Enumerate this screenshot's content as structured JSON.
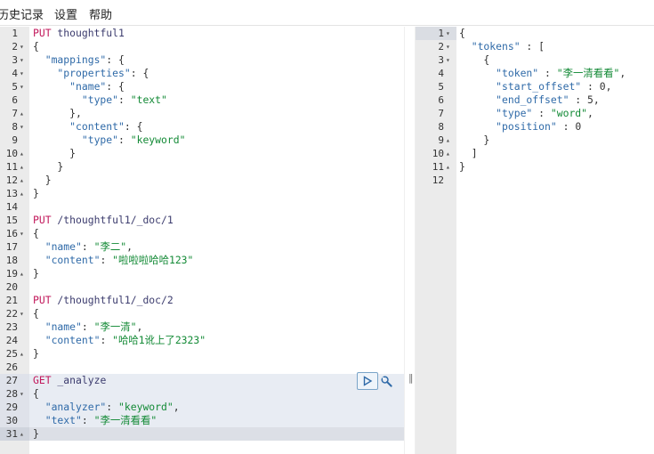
{
  "menu": {
    "history": "历史记录",
    "settings": "设置",
    "help": "帮助"
  },
  "request_editor": {
    "lines": [
      {
        "n": "1",
        "fold": "",
        "tokens": [
          [
            "method",
            "PUT"
          ],
          [
            "path",
            " thoughtful1"
          ]
        ]
      },
      {
        "n": "2",
        "fold": "▾",
        "tokens": [
          [
            "punc",
            "{"
          ]
        ]
      },
      {
        "n": "3",
        "fold": "▾",
        "tokens": [
          [
            "key",
            "  \"mappings\""
          ],
          [
            "punc",
            ": {"
          ]
        ]
      },
      {
        "n": "4",
        "fold": "▾",
        "tokens": [
          [
            "key",
            "    \"properties\""
          ],
          [
            "punc",
            ": {"
          ]
        ]
      },
      {
        "n": "5",
        "fold": "▾",
        "tokens": [
          [
            "key",
            "      \"name\""
          ],
          [
            "punc",
            ": {"
          ]
        ]
      },
      {
        "n": "6",
        "fold": "",
        "tokens": [
          [
            "key",
            "        \"type\""
          ],
          [
            "punc",
            ": "
          ],
          [
            "str",
            "\"text\""
          ]
        ]
      },
      {
        "n": "7",
        "fold": "▴",
        "tokens": [
          [
            "punc",
            "      },"
          ]
        ]
      },
      {
        "n": "8",
        "fold": "▾",
        "tokens": [
          [
            "key",
            "      \"content\""
          ],
          [
            "punc",
            ": {"
          ]
        ]
      },
      {
        "n": "9",
        "fold": "",
        "tokens": [
          [
            "key",
            "        \"type\""
          ],
          [
            "punc",
            ": "
          ],
          [
            "str",
            "\"keyword\""
          ]
        ]
      },
      {
        "n": "10",
        "fold": "▴",
        "tokens": [
          [
            "punc",
            "      }"
          ]
        ]
      },
      {
        "n": "11",
        "fold": "▴",
        "tokens": [
          [
            "punc",
            "    }"
          ]
        ]
      },
      {
        "n": "12",
        "fold": "▴",
        "tokens": [
          [
            "punc",
            "  }"
          ]
        ]
      },
      {
        "n": "13",
        "fold": "▴",
        "tokens": [
          [
            "punc",
            "}"
          ]
        ]
      },
      {
        "n": "14",
        "fold": "",
        "tokens": []
      },
      {
        "n": "15",
        "fold": "",
        "tokens": [
          [
            "method",
            "PUT"
          ],
          [
            "path",
            " /thoughtful1/_doc/1"
          ]
        ]
      },
      {
        "n": "16",
        "fold": "▾",
        "tokens": [
          [
            "punc",
            "{"
          ]
        ]
      },
      {
        "n": "17",
        "fold": "",
        "tokens": [
          [
            "key",
            "  \"name\""
          ],
          [
            "punc",
            ": "
          ],
          [
            "str",
            "\"李二\""
          ],
          [
            "punc",
            ","
          ]
        ]
      },
      {
        "n": "18",
        "fold": "",
        "tokens": [
          [
            "key",
            "  \"content\""
          ],
          [
            "punc",
            ": "
          ],
          [
            "str",
            "\"啦啦啦哈哈123\""
          ]
        ]
      },
      {
        "n": "19",
        "fold": "▴",
        "tokens": [
          [
            "punc",
            "}"
          ]
        ]
      },
      {
        "n": "20",
        "fold": "",
        "tokens": []
      },
      {
        "n": "21",
        "fold": "",
        "tokens": [
          [
            "method",
            "PUT"
          ],
          [
            "path",
            " /thoughtful1/_doc/2"
          ]
        ]
      },
      {
        "n": "22",
        "fold": "▾",
        "tokens": [
          [
            "punc",
            "{"
          ]
        ]
      },
      {
        "n": "23",
        "fold": "",
        "tokens": [
          [
            "key",
            "  \"name\""
          ],
          [
            "punc",
            ": "
          ],
          [
            "str",
            "\"李一清\""
          ],
          [
            "punc",
            ","
          ]
        ]
      },
      {
        "n": "24",
        "fold": "",
        "tokens": [
          [
            "key",
            "  \"content\""
          ],
          [
            "punc",
            ": "
          ],
          [
            "str",
            "\"哈哈1讹上了2323\""
          ]
        ]
      },
      {
        "n": "25",
        "fold": "▴",
        "tokens": [
          [
            "punc",
            "}"
          ]
        ]
      },
      {
        "n": "26",
        "fold": "",
        "tokens": []
      },
      {
        "n": "27",
        "fold": "",
        "hl": true,
        "tokens": [
          [
            "method",
            "GET"
          ],
          [
            "path",
            " _analyze"
          ]
        ]
      },
      {
        "n": "28",
        "fold": "▾",
        "hl": true,
        "tokens": [
          [
            "punc",
            "{"
          ]
        ]
      },
      {
        "n": "29",
        "fold": "",
        "hl": true,
        "tokens": [
          [
            "key",
            "  \"analyzer\""
          ],
          [
            "punc",
            ": "
          ],
          [
            "str",
            "\"keyword\""
          ],
          [
            "punc",
            ","
          ]
        ]
      },
      {
        "n": "30",
        "fold": "",
        "hl": true,
        "tokens": [
          [
            "key",
            "  \"text\""
          ],
          [
            "punc",
            ": "
          ],
          [
            "str",
            "\"李一清看看\""
          ]
        ]
      },
      {
        "n": "31",
        "fold": "▴",
        "hl": true,
        "cursor": true,
        "tokens": [
          [
            "punc",
            "}"
          ]
        ]
      }
    ]
  },
  "response_editor": {
    "lines": [
      {
        "n": "1",
        "fold": "▾",
        "tokens": [
          [
            "punc",
            "{"
          ]
        ]
      },
      {
        "n": "2",
        "fold": "▾",
        "tokens": [
          [
            "key",
            "  \"tokens\""
          ],
          [
            "punc",
            " : ["
          ]
        ]
      },
      {
        "n": "3",
        "fold": "▾",
        "tokens": [
          [
            "punc",
            "    {"
          ]
        ]
      },
      {
        "n": "4",
        "fold": "",
        "tokens": [
          [
            "key",
            "      \"token\""
          ],
          [
            "punc",
            " : "
          ],
          [
            "str",
            "\"李一清看看\""
          ],
          [
            "punc",
            ","
          ]
        ]
      },
      {
        "n": "5",
        "fold": "",
        "tokens": [
          [
            "key",
            "      \"start_offset\""
          ],
          [
            "punc",
            " : "
          ],
          [
            "num",
            "0"
          ],
          [
            "punc",
            ","
          ]
        ]
      },
      {
        "n": "6",
        "fold": "",
        "tokens": [
          [
            "key",
            "      \"end_offset\""
          ],
          [
            "punc",
            " : "
          ],
          [
            "num",
            "5"
          ],
          [
            "punc",
            ","
          ]
        ]
      },
      {
        "n": "7",
        "fold": "",
        "tokens": [
          [
            "key",
            "      \"type\""
          ],
          [
            "punc",
            " : "
          ],
          [
            "str",
            "\"word\""
          ],
          [
            "punc",
            ","
          ]
        ]
      },
      {
        "n": "8",
        "fold": "",
        "tokens": [
          [
            "key",
            "      \"position\""
          ],
          [
            "punc",
            " : "
          ],
          [
            "num",
            "0"
          ]
        ]
      },
      {
        "n": "9",
        "fold": "▴",
        "tokens": [
          [
            "punc",
            "    }"
          ]
        ]
      },
      {
        "n": "10",
        "fold": "▴",
        "tokens": [
          [
            "punc",
            "  ]"
          ]
        ]
      },
      {
        "n": "11",
        "fold": "▴",
        "tokens": [
          [
            "punc",
            "}"
          ]
        ]
      },
      {
        "n": "12",
        "fold": "",
        "tokens": []
      }
    ]
  },
  "icons": {
    "run": "play-icon",
    "settings": "wrench-icon"
  },
  "colors": {
    "method": "#c2185b",
    "key": "#2f6aa8",
    "string": "#138a36",
    "gutter": "#ebebeb",
    "active_request": "#e8ecf3"
  }
}
